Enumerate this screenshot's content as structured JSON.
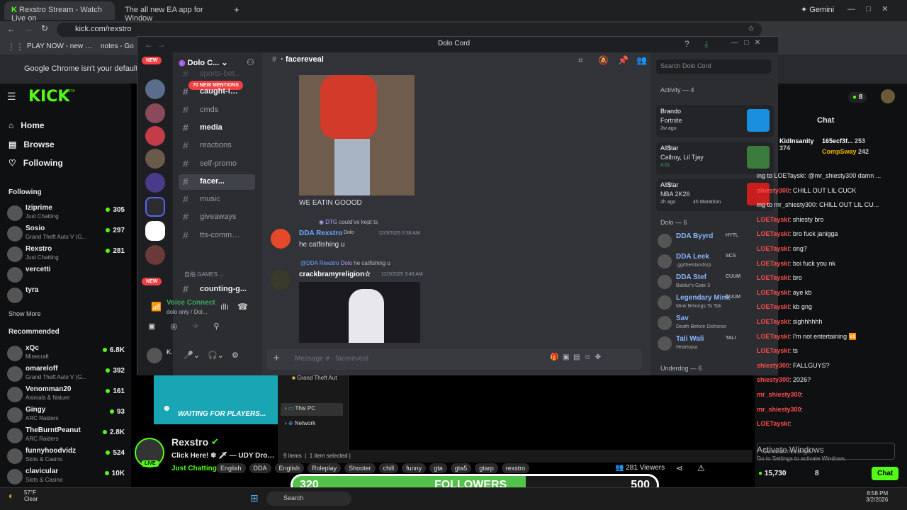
{
  "chrome": {
    "tabs": [
      "Rexstro Stream - Watch Live on",
      "The all new EA app for Window"
    ],
    "url": "kick.com/rexstro",
    "bookmarks": [
      "PLAY NOW - new d...",
      "notes - Go"
    ],
    "gemini": "Gemini",
    "infobar": "Google Chrome isn't your default browser"
  },
  "kick": {
    "logo": "KICK",
    "beta": "BETA",
    "nav": [
      "Home",
      "Browse",
      "Following"
    ],
    "following_title": "Following",
    "following": [
      {
        "name": "Iziprime",
        "cat": "Just Chatting",
        "viewers": "305"
      },
      {
        "name": "Sosio",
        "cat": "Grand Theft Auto V (G...",
        "viewers": "297"
      },
      {
        "name": "Rexstro",
        "cat": "Just Chatting",
        "viewers": "281"
      },
      {
        "name": "vercetti",
        "cat": "",
        "viewers": ""
      },
      {
        "name": "tyra",
        "cat": "",
        "viewers": ""
      }
    ],
    "show_more": "Show More",
    "recommended_title": "Recommended",
    "recommended": [
      {
        "name": "xQc",
        "cat": "Minecraft",
        "viewers": "6.8K"
      },
      {
        "name": "omareloff",
        "cat": "Grand Theft Auto V (G...",
        "viewers": "392"
      },
      {
        "name": "Venomman20",
        "cat": "Animals & Nature",
        "viewers": "161"
      },
      {
        "name": "Gingy",
        "cat": "ARC Raiders",
        "viewers": "93"
      },
      {
        "name": "TheBurntPeanut",
        "cat": "ARC Raiders",
        "viewers": "2.8K"
      },
      {
        "name": "funnyhoodvidz",
        "cat": "Slots & Casino",
        "viewers": "524"
      },
      {
        "name": "clavicular",
        "cat": "Slots & Casino",
        "viewers": "10K"
      }
    ],
    "streamer": "Rexstro",
    "stream_title": "Click Here! ❄ 🗡 — UDY Dropped",
    "live": "LIVE",
    "category": "Just Chatting",
    "tags": [
      "English",
      "DDA",
      "English",
      "Roleplay",
      "Shooter",
      "chill",
      "funny",
      "gta",
      "gta5",
      "gtarp",
      "rexstro"
    ],
    "viewers": "281 Viewers",
    "waiting": "WAITING FOR PLAYERS...",
    "points": "8",
    "balance": "15,730",
    "coins": "8"
  },
  "chat": {
    "title": "Chat",
    "leaders": [
      {
        "name": "KidInsanity",
        "amount": "374"
      },
      {
        "name": "165ecf3f...",
        "amount": "253"
      },
      {
        "name": "CompSway",
        "amount": "242"
      }
    ],
    "messages": [
      {
        "user": "",
        "text": "ing to LOETayski: @mr_shiesty300 damn ..."
      },
      {
        "user": "shiesty300",
        "text": ": CHILL OUT LIL CUCK"
      },
      {
        "user": "",
        "text": "ing to mr_shiesty300: CHILL OUT LIL CU..."
      },
      {
        "user": "LOETayski",
        "text": ": shiesty bro"
      },
      {
        "user": "LOETayski",
        "text": ": bro fuck janigga"
      },
      {
        "user": "LOETayski",
        "text": ": ong?"
      },
      {
        "user": "LOETayski",
        "text": ": boi fuck you nk"
      },
      {
        "user": "LOETayski",
        "text": ": bro"
      },
      {
        "user": "LOETayski",
        "text": ": aye kb"
      },
      {
        "user": "LOETayski",
        "text": ": kb gng"
      },
      {
        "user": "LOETayski",
        "text": ": sighhhhhh"
      },
      {
        "user": "LOETayski",
        "text": ": I'm not entertaining 🆚"
      },
      {
        "user": "LOETayski",
        "text": ": ts"
      },
      {
        "user": "shiesty300",
        "text": ": FALLGUYS?"
      },
      {
        "user": "shiesty300",
        "text": ": 2026?"
      },
      {
        "user": "mr_shiesty300",
        "text": ":"
      },
      {
        "user": "mr_shiesty300",
        "text": ":"
      },
      {
        "user": "LOETayski",
        "text": ":"
      }
    ],
    "send_placeholder": "Send a message",
    "send_button": "Chat",
    "watermark1": "Activate Windows",
    "watermark2": "Go to Settings to activate Windows."
  },
  "discord": {
    "window_title": "Dolo Cord",
    "server_name": "Dolo C...",
    "new_badge": "NEW",
    "mentions": "70 NEW MENTIONS",
    "channels": [
      {
        "name": "sports-bet...",
        "unread": false
      },
      {
        "name": "caught-in-...",
        "unread": true
      },
      {
        "name": "cmds",
        "unread": false
      },
      {
        "name": "media",
        "unread": true
      },
      {
        "name": "reactions",
        "unread": false
      },
      {
        "name": "self-promo",
        "unread": false
      },
      {
        "name": "facer...",
        "unread": true
      },
      {
        "name": "music",
        "unread": false
      },
      {
        "name": "giveaways",
        "unread": false
      },
      {
        "name": "tts-comma...",
        "unread": false
      }
    ],
    "category": "自拍 GAMES ...",
    "counting": "counting-g...",
    "voice_status": "Voice Connect",
    "voice_sub": "dolo only / Dol...",
    "user_short": "K.",
    "channel": "facereveal",
    "search": "Search Dolo Cord",
    "messages": [
      {
        "text": "WE EATIN GOOOD"
      },
      {
        "reply": "could've kept ts",
        "reply_tag": "DTG",
        "author": "DDA Rexstro",
        "tag": "Dolo",
        "time": "12/3/2025 2:38 AM",
        "text": "he catfishing u"
      },
      {
        "reply": "@DDA Rexstro",
        "reply_tag": "Dolo",
        "reply_text": "he catfishing u",
        "author": "crackbramyreligion☆",
        "time": "12/3/2025 3:46 AM"
      }
    ],
    "input_placeholder": "Message # · facereveal",
    "activity_title": "Activity — 4",
    "activity": [
      {
        "name": "Brando",
        "game": "Fortnite",
        "time": "2w ago"
      },
      {
        "name": "All$tar",
        "game": "Calboy, Lil Tjay",
        "time": "4:01"
      },
      {
        "name": "All$tar",
        "game": "NBA 2K26",
        "time": "2h ago",
        "extra": "4h Marathon"
      }
    ],
    "role_title": "Dolo — 6",
    "members": [
      {
        "name": "DDA Byyrd",
        "tag": "HYTL",
        "status": ""
      },
      {
        "name": "DDA Leek",
        "tag": "SCS",
        "status": ".gg/theislandsrp"
      },
      {
        "name": "DDA Stef",
        "tag": "CUUM",
        "status": "Baldur's Gate 3"
      },
      {
        "name": "Legendary Mink",
        "tag": "CUUM",
        "status": "Mink Belongs To Tali"
      },
      {
        "name": "Sav",
        "tag": "",
        "status": "Death Before Dishonor"
      },
      {
        "name": "Tali Wali",
        "tag": "TALI",
        "status": "Heartopia"
      }
    ],
    "underdog_title": "Underdog — 6"
  },
  "explorer": {
    "items": [
      "Grand Theft Aut",
      "This PC",
      "Network"
    ],
    "status_items": "9 items",
    "status_selected": "1 item selected"
  },
  "overlay": {
    "left": "320",
    "label": "FOLLOWERS",
    "right": "500",
    "fill": 0.64
  },
  "taskbar": {
    "temp": "57°F",
    "weather": "Clear",
    "search": "Search",
    "time": "8:58 PM",
    "date": "3/2/2026"
  },
  "colors": {
    "kick_green": "#53fc18",
    "discord_bg": "#313338"
  }
}
